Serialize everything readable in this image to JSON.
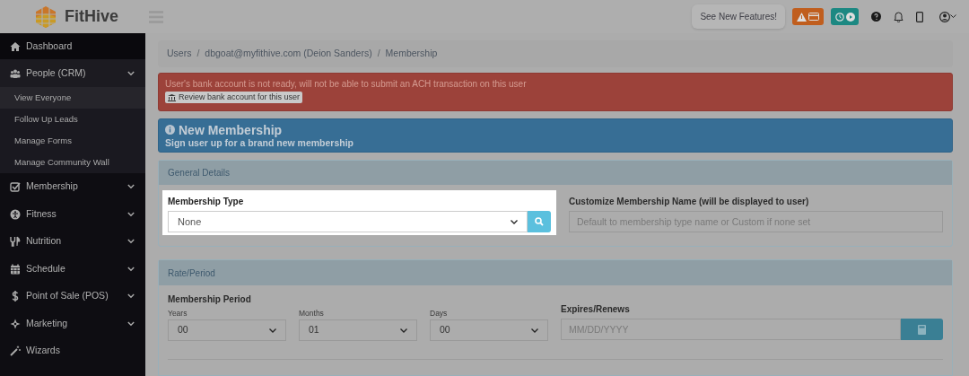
{
  "brand": {
    "name": "FitHive"
  },
  "topbar": {
    "tooltip": "See New Features!"
  },
  "sidebar": {
    "items": [
      {
        "label": "Dashboard"
      },
      {
        "label": "People (CRM)",
        "expanded": true,
        "children": [
          {
            "label": "View Everyone",
            "selected": true
          },
          {
            "label": "Follow Up Leads",
            "selected": false
          },
          {
            "label": "Manage Forms",
            "selected": false
          },
          {
            "label": "Manage Community Wall",
            "selected": false
          }
        ]
      },
      {
        "label": "Membership",
        "expanded": false
      },
      {
        "label": "Fitness",
        "expanded": false
      },
      {
        "label": "Nutrition",
        "expanded": false
      },
      {
        "label": "Schedule",
        "expanded": false
      },
      {
        "label": "Point of Sale (POS)",
        "expanded": false
      },
      {
        "label": "Marketing",
        "expanded": false
      },
      {
        "label": "Wizards"
      }
    ]
  },
  "breadcrumb": [
    {
      "kind": "link",
      "text": "Users"
    },
    {
      "kind": "separator",
      "text": "/"
    },
    {
      "kind": "link",
      "text": "dbgoat@myfithive.com (Deion Sanders)"
    },
    {
      "kind": "separator",
      "text": "/"
    },
    {
      "kind": "current",
      "text": "Membership"
    }
  ],
  "alert": {
    "message": "User's bank account is not ready, will not be able to submit an ACH transaction on this user",
    "button": "Review bank account for this user"
  },
  "heading": {
    "title": "New Membership",
    "subtitle": "Sign user up for a brand new membership"
  },
  "general_details": {
    "title": "General Details",
    "membership_type": {
      "label": "Membership Type",
      "value": "None"
    },
    "custom_name": {
      "label": "Customize Membership Name (will be displayed to user)",
      "placeholder": "Default to membership type name or Custom if none set"
    }
  },
  "rate_period": {
    "title": "Rate/Period",
    "period_label": "Membership Period",
    "selects": [
      {
        "label": "Years",
        "value": "00"
      },
      {
        "label": "Months",
        "value": "01"
      },
      {
        "label": "Days",
        "value": "00"
      }
    ],
    "expires": {
      "label": "Expires/Renews",
      "placeholder": "MM/DD/YYYY"
    }
  }
}
